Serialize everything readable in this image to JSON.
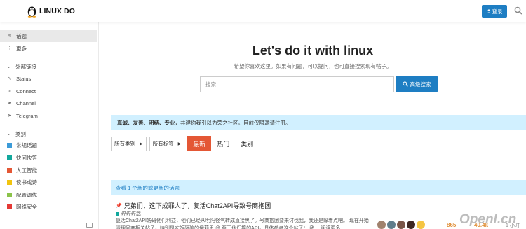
{
  "header": {
    "logo_text": "LINUX DO",
    "login_label": "登录",
    "icons": [
      "penguin-logo-icon",
      "user-icon",
      "search-icon"
    ]
  },
  "sidebar": {
    "top_items": [
      {
        "label": "话题",
        "icon": "layers-icon",
        "active": true
      },
      {
        "label": "更多",
        "icon": "more-vertical-icon",
        "active": false
      }
    ],
    "links_header": "外部链接",
    "links": [
      {
        "label": "Status",
        "icon": "heartbeat-icon"
      },
      {
        "label": "Connect",
        "icon": "link-icon"
      },
      {
        "label": "Channel",
        "icon": "paper-plane-icon"
      },
      {
        "label": "Telegram",
        "icon": "telegram-icon"
      }
    ],
    "categories_header": "类别",
    "categories": [
      {
        "label": "常规话题",
        "color": "#3b9bd8"
      },
      {
        "label": "快问快答",
        "color": "#12a89d"
      },
      {
        "label": "人工智能",
        "color": "#e45735"
      },
      {
        "label": "读书成诗",
        "color": "#f1c40f"
      },
      {
        "label": "配置调优",
        "color": "#8bc34a"
      },
      {
        "label": "网络安全",
        "color": "#e53935"
      }
    ]
  },
  "hero": {
    "title": "Let's do it with linux",
    "subtitle": "希望你喜欢这里。如果有问题，可以提问，也可直接搜索现有帖子。",
    "search_placeholder": "搜索",
    "advanced_search_label": "高级搜索"
  },
  "banner": {
    "bold": "真诚、友善、团结、专业",
    "text": "，共建你我引以为荣之社区。目前仅限邀请注册。"
  },
  "filters": {
    "all_categories": "所有类别",
    "all_tags": "所有标签",
    "tabs": [
      {
        "label": "最新",
        "active": true
      },
      {
        "label": "热门",
        "active": false
      },
      {
        "label": "类别",
        "active": false
      }
    ]
  },
  "new_topics_label": "查看 1 个新的或更新的话题",
  "topic": {
    "title": "兄弟们，这下成罪人了，复活Chat2API导致号商抱团",
    "category": "碎碎碎念",
    "category_color": "#12a89d",
    "excerpt": "复活Chat2API妨碍他们利益，他们已经从明阳怪气转成直接黑了。号商抱团要来讨伐我，我还是躲着点吧。 现在开始清理号商相关帖子。特别是吃饭砸碗的伊莉思 😊 至于他们撞的API，具体参考这个帖子： 我… 阅读更多",
    "replies": "865",
    "views": "40.4k",
    "activity": "1 小时",
    "avatar_colors": [
      "#a0826d",
      "#607d8b",
      "#795548",
      "#3e2723",
      "#f5c542"
    ]
  },
  "watermark": "Openl.cn"
}
